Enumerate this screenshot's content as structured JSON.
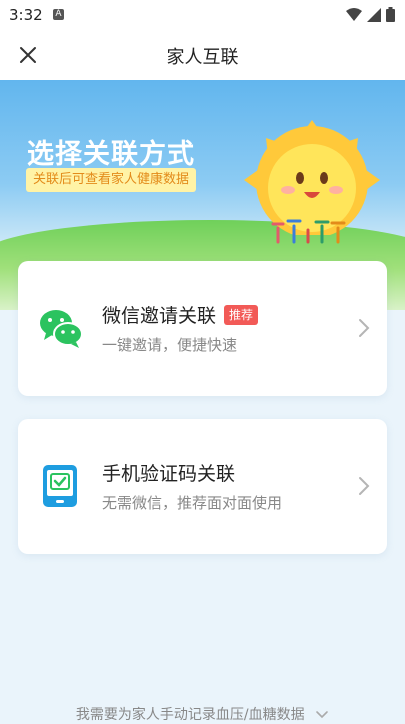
{
  "status_bar": {
    "time": "3:32",
    "notification_icon_label": "A"
  },
  "header": {
    "title": "家人互联"
  },
  "hero": {
    "headline": "选择关联方式",
    "subtitle": "关联后可查看家人健康数据"
  },
  "options": [
    {
      "title": "微信邀请关联",
      "badge": "推荐",
      "subtitle": "一键邀请，便捷快速",
      "icon": "wechat-icon"
    },
    {
      "title": "手机验证码关联",
      "subtitle": "无需微信，推荐面对面使用",
      "icon": "phone-verify-icon"
    }
  ],
  "footer": {
    "manual_record_link": "我需要为家人手动记录血压/血糖数据"
  },
  "colors": {
    "accent_green": "#2bc35f",
    "badge_red": "#f25a57",
    "tag_bg": "#fff3a6",
    "tag_text": "#e38b1a",
    "phone_blue": "#1e9de0"
  }
}
